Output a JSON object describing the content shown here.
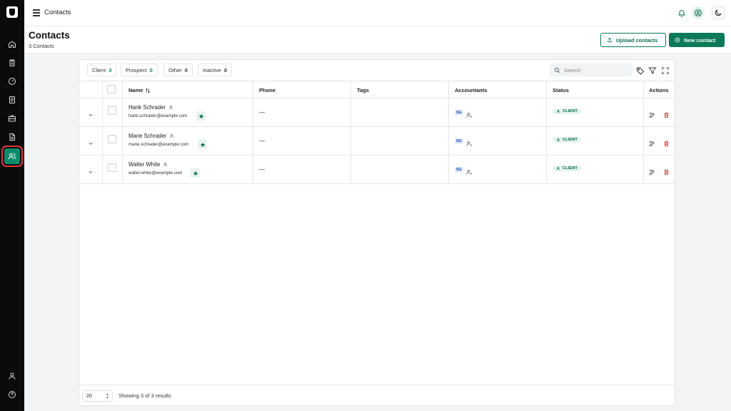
{
  "topbar": {
    "title": "Contacts"
  },
  "header": {
    "title": "Contacts",
    "subtitle": "3 Contacts",
    "upload_label": "Upload contacts",
    "new_label": "New contact"
  },
  "filters": [
    {
      "label": "Client",
      "count": "3"
    },
    {
      "label": "Prospect",
      "count": "0"
    },
    {
      "label": "Other",
      "count": "0"
    },
    {
      "label": "Inactive",
      "count": "0"
    }
  ],
  "search": {
    "placeholder": "Search"
  },
  "columns": {
    "name": "Name",
    "phone": "Phone",
    "tags": "Tags",
    "accountants": "Accountants",
    "status": "Status",
    "actions": "Actions"
  },
  "rows": [
    {
      "name": "Hank Schrader",
      "email": "hank.schrader@example.com",
      "phone": "—",
      "accountant": "SG",
      "status": "CLIENT"
    },
    {
      "name": "Marie Schrader",
      "email": "marie.schrader@example.com",
      "phone": "—",
      "accountant": "SG",
      "status": "CLIENT"
    },
    {
      "name": "Walter White",
      "email": "walter.white@example.com",
      "phone": "—",
      "accountant": "SG",
      "status": "CLIENT"
    }
  ],
  "footer": {
    "page_size": "20",
    "showing": "Showing 3 of 3 results"
  },
  "colors": {
    "brand": "#0a7a58",
    "danger": "#cf2a2a",
    "active_highlight": "#e0383d"
  },
  "icons": [
    "logo-icon",
    "home-icon",
    "clipboard-icon",
    "gauge-icon",
    "document-icon",
    "briefcase-icon",
    "file-icon",
    "users-icon",
    "user-icon",
    "help-icon",
    "menu-icon",
    "bell-icon",
    "user-circle-icon",
    "moon-icon",
    "upload-icon",
    "plus-circle-icon",
    "search-icon",
    "tag-icon",
    "filter-icon",
    "expand-icon",
    "sort-icon",
    "chevron-down-icon",
    "person-icon",
    "star-icon",
    "user-plus-icon",
    "edit-icon",
    "trash-icon"
  ]
}
